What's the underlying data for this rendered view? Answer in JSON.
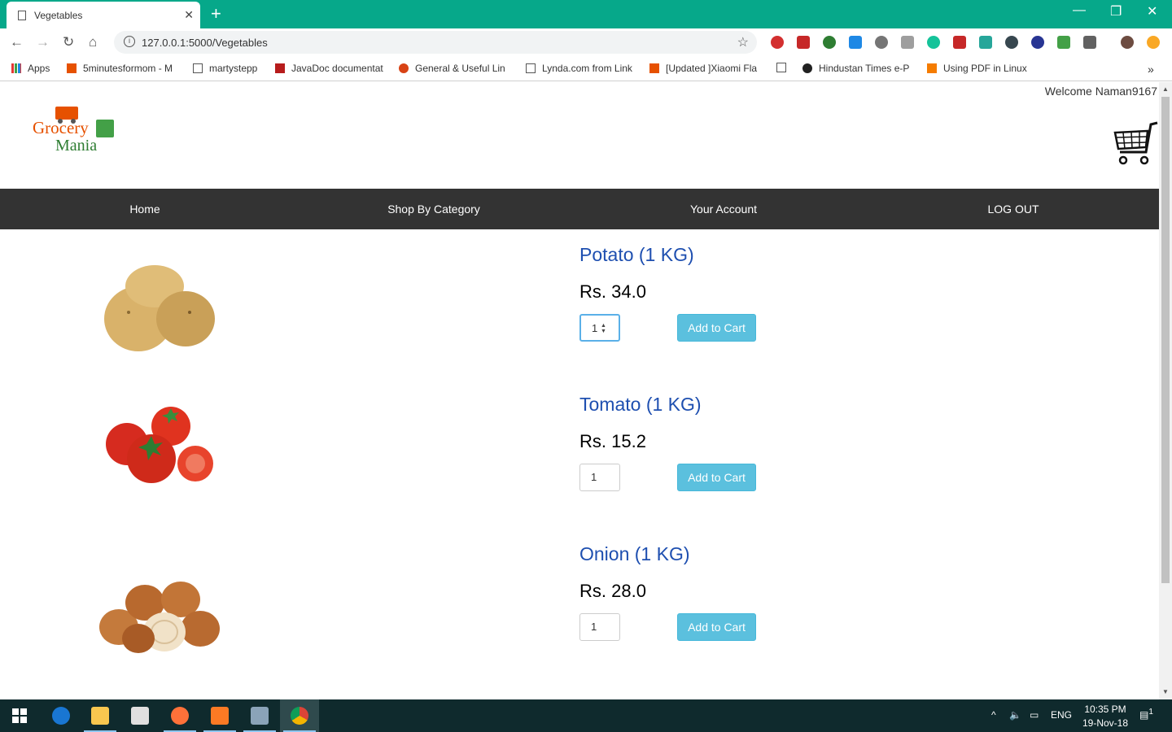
{
  "browser": {
    "tab_title": "Vegetables",
    "url": "127.0.0.1:5000/Vegetables",
    "bookmarks": [
      {
        "label": "Apps"
      },
      {
        "label": "5minutesformom - M"
      },
      {
        "label": "martystepp"
      },
      {
        "label": "JavaDoc documentat"
      },
      {
        "label": "General & Useful Lin"
      },
      {
        "label": "Lynda.com from Link"
      },
      {
        "label": "[Updated ]Xiaomi Fla"
      },
      {
        "label": ""
      },
      {
        "label": "Hindustan Times e-P"
      },
      {
        "label": "Using PDF in Linux"
      }
    ]
  },
  "header": {
    "welcome": "Welcome Naman9167",
    "logo_line1": "Grocery",
    "logo_line2": "Mania"
  },
  "nav": {
    "items": [
      "Home",
      "Shop By Category",
      "Your Account",
      "LOG OUT"
    ]
  },
  "products": [
    {
      "name": "Potato (1 KG)",
      "price": "Rs. 34.0",
      "qty": "1",
      "button": "Add to Cart"
    },
    {
      "name": "Tomato (1 KG)",
      "price": "Rs. 15.2",
      "qty": "1",
      "button": "Add to Cart"
    },
    {
      "name": "Onion (1 KG)",
      "price": "Rs. 28.0",
      "qty": "1",
      "button": "Add to Cart"
    }
  ],
  "taskbar": {
    "lang": "ENG",
    "time": "10:35 PM",
    "date": "19-Nov-18",
    "notifications": "1"
  },
  "colors": {
    "titlebar": "#06a88a",
    "navbar": "#333333",
    "product_name": "#1e4fb0",
    "add_button": "#5bc0de",
    "taskbar": "#0f2a2d"
  }
}
